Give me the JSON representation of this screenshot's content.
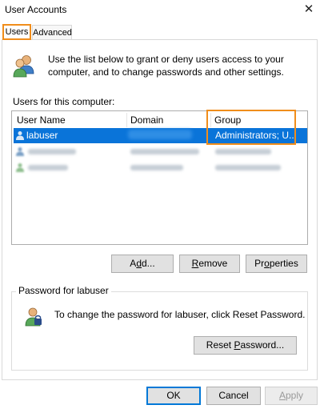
{
  "window": {
    "title": "User Accounts",
    "close_glyph": "✕"
  },
  "tabs": [
    {
      "label": "Users",
      "selected": true
    },
    {
      "label": "Advanced",
      "selected": false
    }
  ],
  "intro": {
    "text": "Use the list below to grant or deny users access to your computer, and to change passwords and other settings."
  },
  "users_list": {
    "label": "Users for this computer:",
    "columns": [
      "User Name",
      "Domain",
      "Group"
    ],
    "rows": [
      {
        "user": "labuser",
        "group": "Administrators; U...",
        "selected": true
      }
    ]
  },
  "buttons": {
    "add": {
      "pre": "A",
      "ul": "d",
      "post": "d..."
    },
    "remove": {
      "pre": "",
      "ul": "R",
      "post": "emove"
    },
    "properties": {
      "pre": "Pr",
      "ul": "o",
      "post": "perties"
    },
    "reset": {
      "pre": "Reset ",
      "ul": "P",
      "post": "assword..."
    },
    "ok": "OK",
    "cancel": "Cancel",
    "apply": {
      "pre": "",
      "ul": "A",
      "post": "pply"
    }
  },
  "password_group": {
    "legend": "Password for labuser",
    "text": "To change the password for labuser, click Reset Password."
  },
  "colors": {
    "accent_highlight": "#f08d1b",
    "selection": "#0a74d9",
    "focus_border": "#0078d7"
  },
  "icons": [
    "close-icon",
    "users-group-icon",
    "user-icon",
    "password-icon"
  ]
}
